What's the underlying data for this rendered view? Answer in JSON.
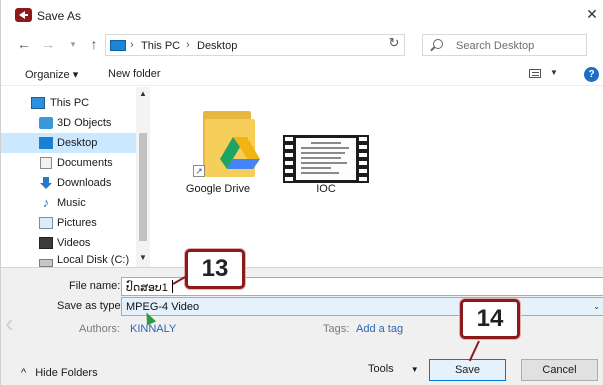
{
  "window": {
    "title": "Save As",
    "icons": {
      "app": "app-back-arrow-icon",
      "close": "close-icon"
    }
  },
  "nav": {
    "breadcrumbs": [
      "This PC",
      "Desktop"
    ],
    "search_placeholder": "Search Desktop",
    "icons": [
      "back-arrow-icon",
      "forward-arrow-icon",
      "recent-dropdown-icon",
      "up-arrow-icon",
      "computer-icon",
      "refresh-icon",
      "search-icon"
    ]
  },
  "toolbar": {
    "organize_label": "Organize ▾",
    "new_folder_label": "New folder",
    "help_label": "?"
  },
  "sidebar": {
    "items": [
      {
        "label": "This PC",
        "icon": "computer-icon"
      },
      {
        "label": "3D Objects",
        "icon": "cube-icon"
      },
      {
        "label": "Desktop",
        "icon": "desktop-icon",
        "selected": true
      },
      {
        "label": "Documents",
        "icon": "document-icon"
      },
      {
        "label": "Downloads",
        "icon": "download-arrow-icon"
      },
      {
        "label": "Music",
        "icon": "music-note-icon"
      },
      {
        "label": "Pictures",
        "icon": "picture-icon"
      },
      {
        "label": "Videos",
        "icon": "video-icon"
      },
      {
        "label": "Local Disk (C:)",
        "icon": "disk-drive-icon"
      }
    ]
  },
  "files": [
    {
      "label": "Google Drive",
      "icon": "google-drive-folder-icon"
    },
    {
      "label": "IOC",
      "icon": "video-file-icon"
    }
  ],
  "form": {
    "file_name_label": "File name:",
    "file_name_value": "ປົດສອບ1",
    "save_type_label": "Save as type:",
    "save_type_value": "MPEG-4 Video",
    "authors_label": "Authors:",
    "authors_value": "KINNALY",
    "tags_label": "Tags:",
    "tags_value": "Add a tag"
  },
  "footer": {
    "hide_folders_label": "Hide Folders",
    "tools_label": "Tools",
    "save_label": "Save",
    "cancel_label": "Cancel"
  },
  "annotations": {
    "step_file_name": "13",
    "step_save": "14"
  },
  "colors": {
    "accent": "#0078d7",
    "selection": "#cce8ff",
    "callout_border": "#8c1a1a",
    "link": "#2a66b4"
  }
}
